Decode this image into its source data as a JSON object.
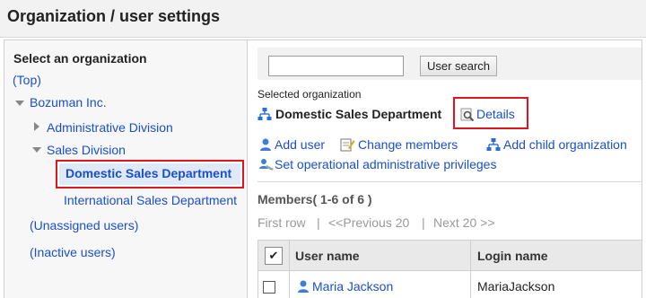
{
  "header": {
    "title": "Organization / user settings"
  },
  "tree": {
    "heading": "Select an organization",
    "top": "(Top)",
    "root": "Bozuman Inc.",
    "admin_division": "Administrative Division",
    "sales_division": "Sales Division",
    "domestic_sales": "Domestic Sales Department",
    "international_sales": "International Sales Department",
    "unassigned": "(Unassigned users)",
    "inactive": "(Inactive users)"
  },
  "search": {
    "value": "",
    "button_label": "User search"
  },
  "selected": {
    "label": "Selected organization",
    "name": "Domestic Sales Department",
    "details_label": "Details"
  },
  "actions": {
    "add_user": "Add user",
    "change_members": "Change members",
    "add_child": "Add child organization",
    "set_privileges": "Set operational administrative privileges"
  },
  "members": {
    "heading": "Members( 1-6 of 6 )",
    "first_row": "First row",
    "sep1": "|",
    "previous": "<<Previous 20",
    "sep2": "|",
    "next": "Next 20 >>"
  },
  "table": {
    "check_all": "✔",
    "col_user_name": "User name",
    "col_login_name": "Login name",
    "rows": [
      {
        "user_name": "Maria Jackson",
        "login_name": "MariaJackson"
      }
    ]
  },
  "colors": {
    "link": "#1a4fcc",
    "highlight": "#e0161f",
    "selected_bg": "#dfe9f7"
  }
}
